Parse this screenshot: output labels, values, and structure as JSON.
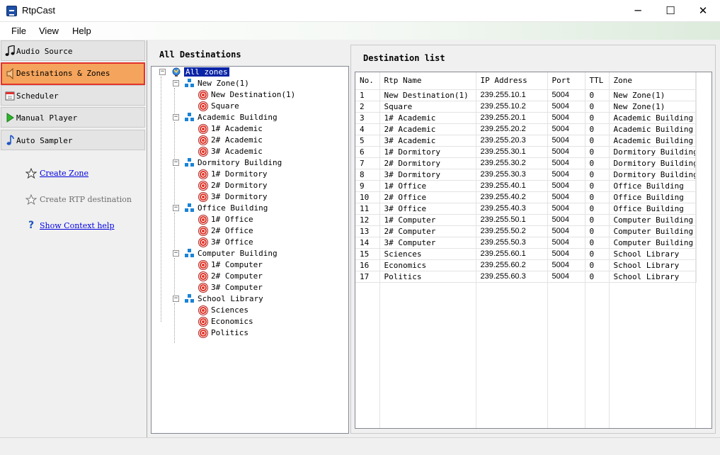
{
  "window": {
    "title": "RtpCast",
    "minimize_glyph": "─",
    "maximize_glyph": "☐",
    "close_glyph": "✕"
  },
  "menu": {
    "items": [
      "File",
      "View",
      "Help"
    ]
  },
  "sidebar": {
    "items": [
      {
        "label": "Audio Source",
        "icon": "music-note-icon"
      },
      {
        "label": "Destinations & Zones",
        "icon": "speaker-icon",
        "selected": true
      },
      {
        "label": "Scheduler",
        "icon": "calendar-icon"
      },
      {
        "label": "Manual Player",
        "icon": "play-icon"
      },
      {
        "label": "Auto Sampler",
        "icon": "music-note-icon"
      }
    ],
    "links": [
      {
        "label": "Create Zone",
        "icon": "star-icon",
        "enabled": true
      },
      {
        "label": "Create RTP destination",
        "icon": "star-icon",
        "enabled": false
      },
      {
        "label": "Show Context help",
        "icon": "help-icon",
        "enabled": true
      }
    ]
  },
  "tree": {
    "header": "All Destinations",
    "root": "All zones",
    "zones": [
      {
        "name": "New Zone(1)",
        "destinations": [
          "New Destination(1)",
          "Square"
        ]
      },
      {
        "name": "Academic Building",
        "destinations": [
          "1# Academic",
          "2# Academic",
          "3# Academic"
        ]
      },
      {
        "name": "Dormitory Building",
        "destinations": [
          "1# Dormitory",
          "2# Dormitory",
          "3# Dormitory"
        ]
      },
      {
        "name": "Office Building",
        "destinations": [
          "1# Office",
          "2# Office",
          "3# Office"
        ]
      },
      {
        "name": "Computer Building",
        "destinations": [
          "1# Computer",
          "2# Computer",
          "3# Computer"
        ]
      },
      {
        "name": "School Library",
        "destinations": [
          "Sciences",
          "Economics",
          "Politics"
        ]
      }
    ]
  },
  "list": {
    "header": "Destination list",
    "columns": [
      "No.",
      "Rtp Name",
      "IP Address",
      "Port",
      "TTL",
      "Zone"
    ],
    "rows": [
      [
        "1",
        "New Destination(1)",
        "239.255.10.1",
        "5004",
        "0",
        "New Zone(1)"
      ],
      [
        "2",
        "Square",
        "239.255.10.2",
        "5004",
        "0",
        "New Zone(1)"
      ],
      [
        "3",
        "1# Academic",
        "239.255.20.1",
        "5004",
        "0",
        "Academic Building"
      ],
      [
        "4",
        "2# Academic",
        "239.255.20.2",
        "5004",
        "0",
        "Academic Building"
      ],
      [
        "5",
        "3# Academic",
        "239.255.20.3",
        "5004",
        "0",
        "Academic Building"
      ],
      [
        "6",
        "1# Dormitory",
        "239.255.30.1",
        "5004",
        "0",
        "Dormitory Building"
      ],
      [
        "7",
        "2# Dormitory",
        "239.255.30.2",
        "5004",
        "0",
        "Dormitory Building"
      ],
      [
        "8",
        "3# Dormitory",
        "239.255.30.3",
        "5004",
        "0",
        "Dormitory Building"
      ],
      [
        "9",
        "1# Office",
        "239.255.40.1",
        "5004",
        "0",
        "Office Building"
      ],
      [
        "10",
        "2# Office",
        "239.255.40.2",
        "5004",
        "0",
        "Office Building"
      ],
      [
        "11",
        "3# Office",
        "239.255.40.3",
        "5004",
        "0",
        "Office Building"
      ],
      [
        "12",
        "1# Computer",
        "239.255.50.1",
        "5004",
        "0",
        "Computer Building"
      ],
      [
        "13",
        "2# Computer",
        "239.255.50.2",
        "5004",
        "0",
        "Computer Building"
      ],
      [
        "14",
        "3# Computer",
        "239.255.50.3",
        "5004",
        "0",
        "Computer Building"
      ],
      [
        "15",
        "Sciences",
        "239.255.60.1",
        "5004",
        "0",
        "School Library"
      ],
      [
        "16",
        "Economics",
        "239.255.60.2",
        "5004",
        "0",
        "School Library"
      ],
      [
        "17",
        "Politics",
        "239.255.60.3",
        "5004",
        "0",
        "School Library"
      ]
    ]
  },
  "colors": {
    "selected_nav": "#f4a45c",
    "highlight_border": "#e3332d",
    "tree_selection": "#0a24a6",
    "link": "#0000e0"
  }
}
